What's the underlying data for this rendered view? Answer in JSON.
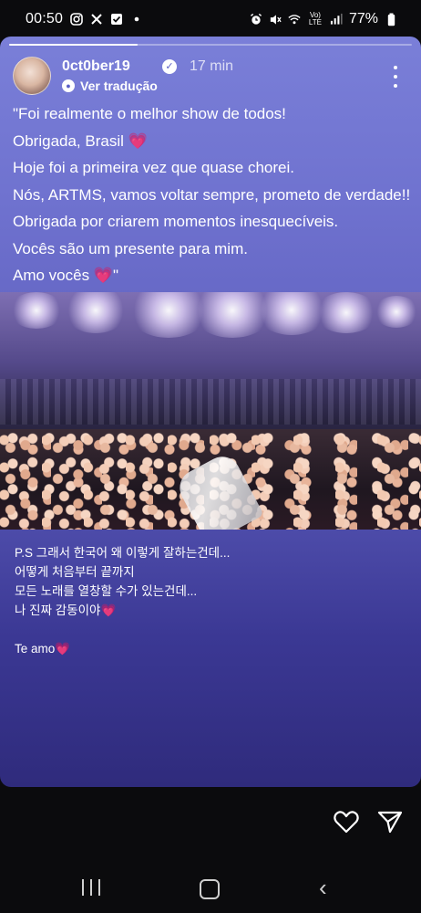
{
  "status_bar": {
    "time": "00:50",
    "battery": "77%",
    "network": "Vo) LTE"
  },
  "story": {
    "progress": 0.32,
    "author": {
      "username": "0ct0ber19",
      "verified": true,
      "time_ago": "17 min"
    },
    "translate_label": "Ver tradução",
    "caption_lines": [
      "\"Foi realmente o melhor show de todos!",
      "Obrigada, Brasil 💗",
      "Hoje foi a primeira vez que quase chorei.",
      "Nós, ARTMS, vamos voltar sempre, prometo de verdade!!",
      "Obrigada por criarem momentos inesquecíveis.",
      "Vocês são um presente para mim.",
      "Amo vocês 💗\""
    ],
    "korean_lines": [
      "P.S 그래서 한국어 왜 이렇게 잘하는건데...",
      "어떻게 처음부터 끝까지",
      "모든 노래를 열창할 수가 있는건데...",
      "나 진짜 감동이야💗"
    ],
    "closing": "Te amo💗",
    "icons": [
      "verified-icon",
      "translate-icon",
      "more-options-icon",
      "heart-icon",
      "send-icon"
    ]
  },
  "nav": {
    "icons": [
      "recents-icon",
      "home-icon",
      "back-icon"
    ]
  }
}
